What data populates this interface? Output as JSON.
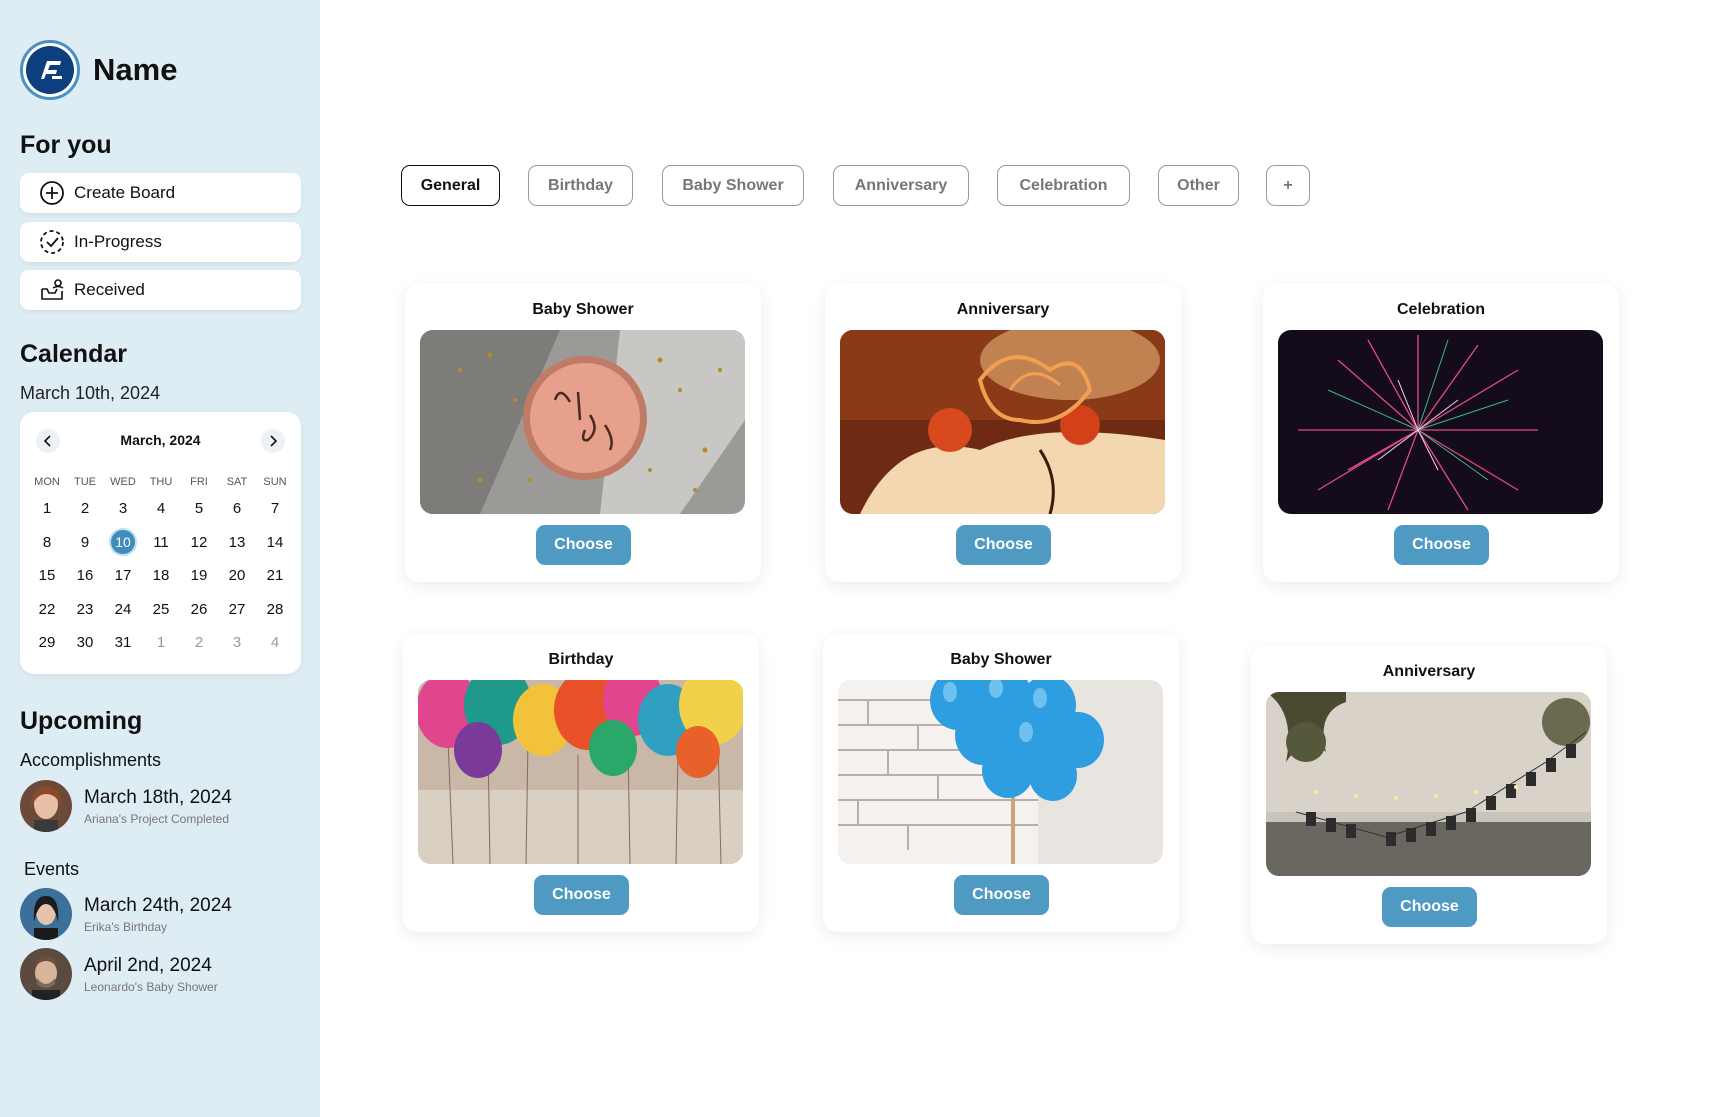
{
  "brand": {
    "name": "Name"
  },
  "sidebar": {
    "for_you_title": "For you",
    "nav": [
      {
        "label": "Create Board",
        "icon": "plus-circle-icon"
      },
      {
        "label": "In-Progress",
        "icon": "progress-check-icon"
      },
      {
        "label": "Received",
        "icon": "inbox-icon"
      }
    ],
    "calendar_title": "Calendar",
    "current_date": "March 10th, 2024",
    "calendar": {
      "month_label": "March, 2024",
      "weekdays": [
        "MON",
        "TUE",
        "WED",
        "THU",
        "FRI",
        "SAT",
        "SUN"
      ],
      "selected_day": "10",
      "weeks": [
        [
          "1",
          "2",
          "3",
          "4",
          "5",
          "6",
          "7"
        ],
        [
          "8",
          "9",
          "10",
          "11",
          "12",
          "13",
          "14"
        ],
        [
          "15",
          "16",
          "17",
          "18",
          "19",
          "20",
          "21"
        ],
        [
          "22",
          "23",
          "24",
          "25",
          "26",
          "27",
          "28"
        ],
        [
          "29",
          "30",
          "31",
          "1",
          "2",
          "3",
          "4"
        ]
      ]
    },
    "upcoming_title": "Upcoming",
    "accomplishments_title": "Accomplishments",
    "accomplishments": [
      {
        "date": "March 18th, 2024",
        "desc": "Ariana's Project Completed"
      }
    ],
    "events_title": "Events",
    "events": [
      {
        "date": "March 24th, 2024",
        "desc": "Erika's Birthday"
      },
      {
        "date": "April 2nd, 2024",
        "desc": "Leonardo's Baby Shower"
      }
    ]
  },
  "tabs": [
    {
      "label": "General",
      "active": true
    },
    {
      "label": "Birthday",
      "active": false
    },
    {
      "label": "Baby Shower",
      "active": false
    },
    {
      "label": "Anniversary",
      "active": false
    },
    {
      "label": "Celebration",
      "active": false
    },
    {
      "label": "Other",
      "active": false
    },
    {
      "label": "+",
      "active": false
    }
  ],
  "cards": [
    {
      "title": "Baby Shower",
      "button": "Choose",
      "image": "oh-baby-cake-photo"
    },
    {
      "title": "Anniversary",
      "button": "Choose",
      "image": "anniversary-cake-photo"
    },
    {
      "title": "Celebration",
      "button": "Choose",
      "image": "fireworks-photo"
    },
    {
      "title": "Birthday",
      "button": "Choose",
      "image": "balloons-photo"
    },
    {
      "title": "Baby Shower",
      "button": "Choose",
      "image": "blue-balloons-photo"
    },
    {
      "title": "Anniversary",
      "button": "Choose",
      "image": "anniversary-banner-photo"
    }
  ],
  "colors": {
    "sidebar_bg": "#deecf3",
    "accent": "#4f9ac3",
    "logo": "#0c3f7e",
    "selected_day": "#3f8dbd"
  }
}
